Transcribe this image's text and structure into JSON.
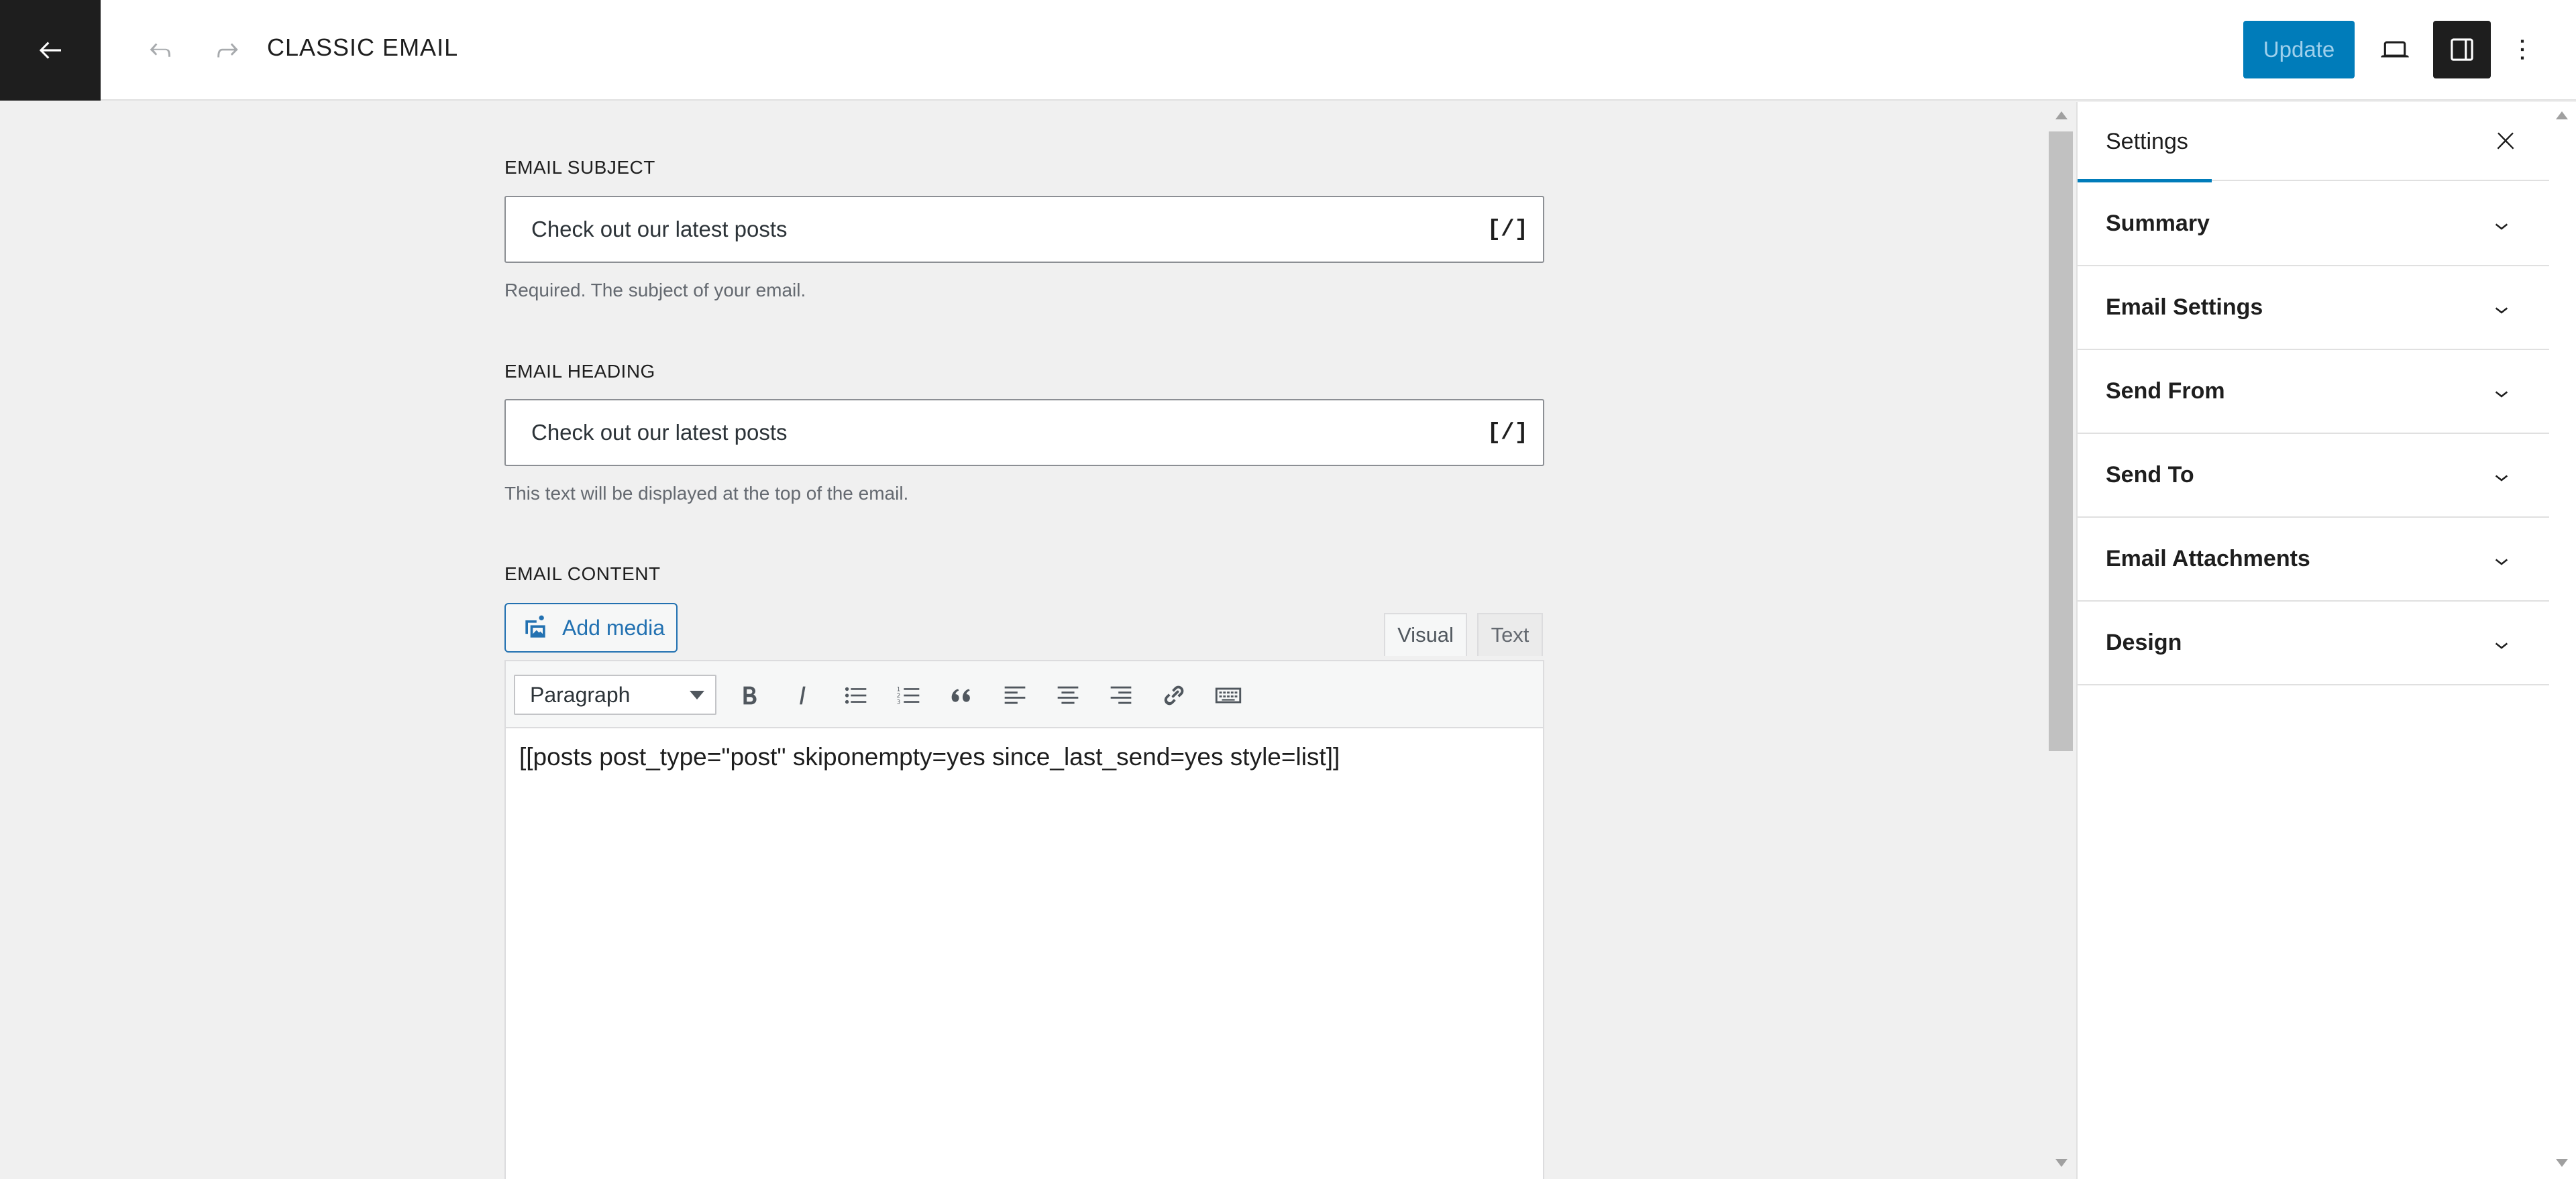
{
  "header": {
    "title": "CLASSIC EMAIL",
    "update_label": "Update"
  },
  "fields": {
    "subject": {
      "label": "EMAIL SUBJECT",
      "value": "Check out our latest posts",
      "tag": "[/]",
      "help": "Required. The subject of your email."
    },
    "heading": {
      "label": "EMAIL HEADING",
      "value": "Check out our latest posts",
      "tag": "[/]",
      "help": "This text will be displayed at the top of the email."
    },
    "content": {
      "label": "EMAIL CONTENT",
      "add_media": "Add media",
      "tab_visual": "Visual",
      "tab_text": "Text",
      "format": "Paragraph",
      "body": "[[posts post_type=\"post\" skiponempty=yes since_last_send=yes style=list]]"
    }
  },
  "sidebar": {
    "tab_label": "Settings",
    "panels": [
      {
        "label": "Summary"
      },
      {
        "label": "Email Settings"
      },
      {
        "label": "Send From"
      },
      {
        "label": "Send To"
      },
      {
        "label": "Email Attachments"
      },
      {
        "label": "Design"
      }
    ]
  },
  "colors": {
    "accent": "#007cba",
    "dark": "#1e1e1e",
    "link": "#2271b1"
  }
}
